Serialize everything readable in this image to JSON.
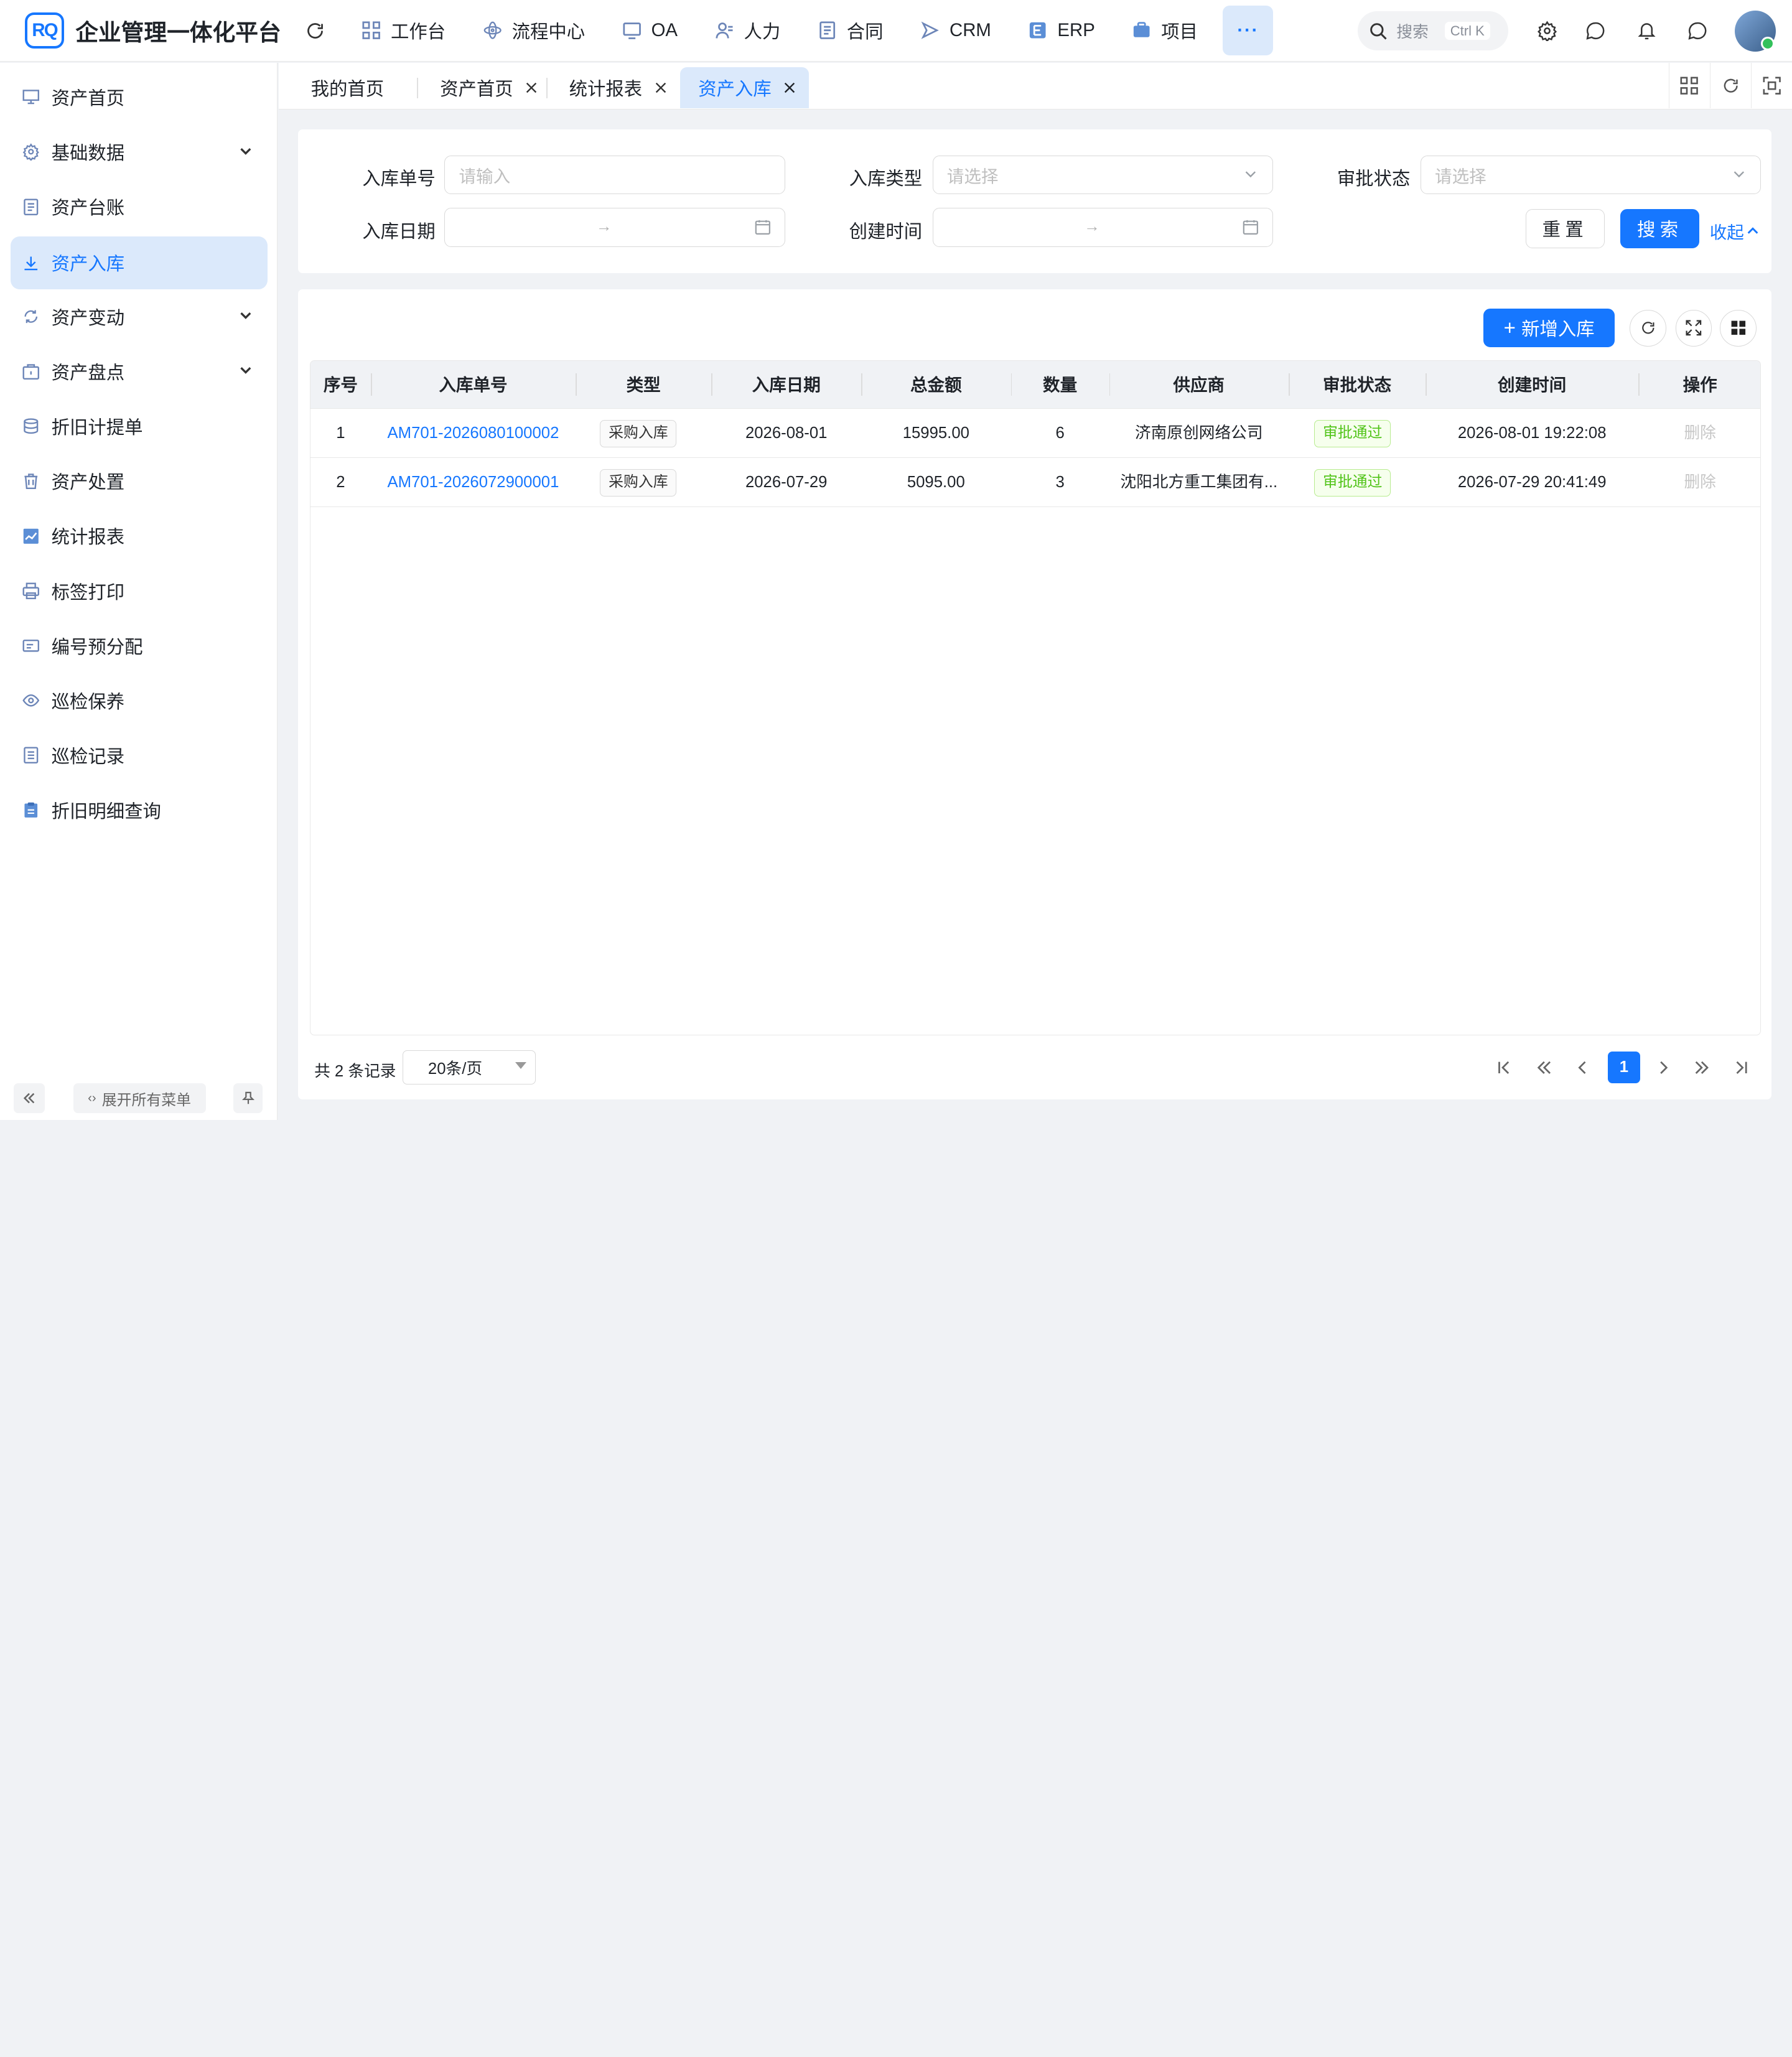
{
  "header": {
    "logo_text": "RQ",
    "app_title": "企业管理一体化平台",
    "nav": [
      {
        "label": "工作台",
        "icon": "grid-icon"
      },
      {
        "label": "流程中心",
        "icon": "flow-icon"
      },
      {
        "label": "OA",
        "icon": "monitor-icon"
      },
      {
        "label": "人力",
        "icon": "person-icon"
      },
      {
        "label": "合同",
        "icon": "document-icon"
      },
      {
        "label": "CRM",
        "icon": "send-icon"
      },
      {
        "label": "ERP",
        "icon": "erp-icon"
      },
      {
        "label": "项目",
        "icon": "briefcase-icon"
      }
    ],
    "more_label": "···",
    "search": {
      "placeholder": "搜索",
      "shortcut": "Ctrl K"
    }
  },
  "sidebar": {
    "items": [
      {
        "label": "资产首页",
        "icon": "dashboard-icon",
        "expandable": false,
        "active": false
      },
      {
        "label": "基础数据",
        "icon": "gear-icon",
        "expandable": true,
        "active": false
      },
      {
        "label": "资产台账",
        "icon": "ledger-icon",
        "expandable": false,
        "active": false
      },
      {
        "label": "资产入库",
        "icon": "download-icon",
        "expandable": false,
        "active": true
      },
      {
        "label": "资产变动",
        "icon": "sync-icon",
        "expandable": true,
        "active": false
      },
      {
        "label": "资产盘点",
        "icon": "box-icon",
        "expandable": true,
        "active": false
      },
      {
        "label": "折旧计提单",
        "icon": "database-icon",
        "expandable": false,
        "active": false
      },
      {
        "label": "资产处置",
        "icon": "trash-icon",
        "expandable": false,
        "active": false
      },
      {
        "label": "统计报表",
        "icon": "chart-icon",
        "expandable": false,
        "active": false
      },
      {
        "label": "标签打印",
        "icon": "printer-icon",
        "expandable": false,
        "active": false
      },
      {
        "label": "编号预分配",
        "icon": "card-icon",
        "expandable": false,
        "active": false
      },
      {
        "label": "巡检保养",
        "icon": "eye-icon",
        "expandable": false,
        "active": false
      },
      {
        "label": "巡检记录",
        "icon": "record-icon",
        "expandable": false,
        "active": false
      },
      {
        "label": "折旧明细查询",
        "icon": "clipboard-icon",
        "expandable": false,
        "active": false
      }
    ],
    "expand_all_label": "展开所有菜单"
  },
  "tabs": [
    {
      "label": "我的首页",
      "closable": false,
      "active": false
    },
    {
      "label": "资产首页",
      "closable": true,
      "active": false
    },
    {
      "label": "统计报表",
      "closable": true,
      "active": false
    },
    {
      "label": "资产入库",
      "closable": true,
      "active": true
    }
  ],
  "filters": {
    "order_no": {
      "label": "入库单号",
      "placeholder": "请输入"
    },
    "type": {
      "label": "入库类型",
      "placeholder": "请选择"
    },
    "status": {
      "label": "审批状态",
      "placeholder": "请选择"
    },
    "date": {
      "label": "入库日期",
      "separator": "→"
    },
    "created": {
      "label": "创建时间",
      "separator": "→"
    },
    "reset_label": "重置",
    "search_label": "搜索",
    "collapse_label": "收起"
  },
  "toolbar": {
    "add_label": "新增入库"
  },
  "table": {
    "columns": [
      "序号",
      "入库单号",
      "类型",
      "入库日期",
      "总金额",
      "数量",
      "供应商",
      "审批状态",
      "创建时间",
      "操作"
    ],
    "rows": [
      {
        "index": "1",
        "order_no": "AM701-2026080100002",
        "type": "采购入库",
        "date": "2026-08-01",
        "amount": "15995.00",
        "qty": "6",
        "supplier": "济南原创网络公司",
        "status": "审批通过",
        "created": "2026-08-01 19:22:08",
        "action": "删除"
      },
      {
        "index": "2",
        "order_no": "AM701-2026072900001",
        "type": "采购入库",
        "date": "2026-07-29",
        "amount": "5095.00",
        "qty": "3",
        "supplier": "沈阳北方重工集团有...",
        "status": "审批通过",
        "created": "2026-07-29 20:41:49",
        "action": "删除"
      }
    ]
  },
  "pagination": {
    "total_text": "共 2 条记录",
    "page_size": "20条/页",
    "current_page": "1"
  }
}
